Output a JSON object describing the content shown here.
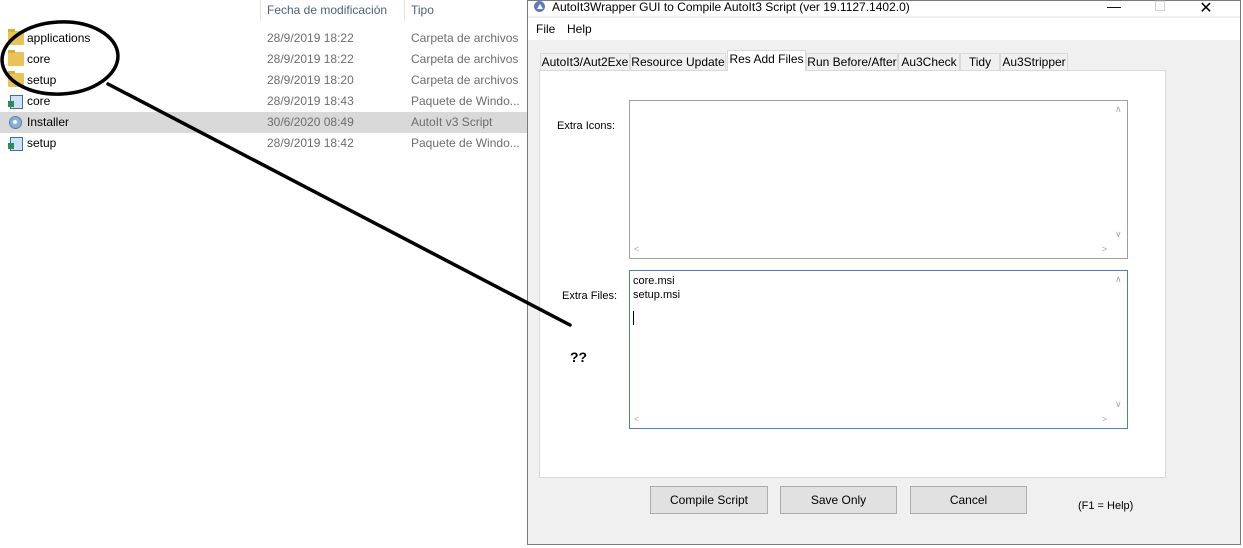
{
  "explorer": {
    "columns": {
      "date": "Fecha de modificación",
      "type": "Tipo"
    },
    "rows": [
      {
        "name": "applications",
        "date": "28/9/2019 18:22",
        "type": "Carpeta de archivos",
        "icon": "folder-icon"
      },
      {
        "name": "core",
        "date": "28/9/2019 18:22",
        "type": "Carpeta de archivos",
        "icon": "folder-icon"
      },
      {
        "name": "setup",
        "date": "28/9/2019 18:20",
        "type": "Carpeta de archivos",
        "icon": "folder-icon"
      },
      {
        "name": "core",
        "date": "28/9/2019 18:43",
        "type": "Paquete de Windo...",
        "icon": "msi-package-icon"
      },
      {
        "name": "Installer",
        "date": "30/6/2020 08:49",
        "type": "AutoIt v3 Script",
        "icon": "autoit-script-icon"
      },
      {
        "name": "setup",
        "date": "28/9/2019 18:42",
        "type": "Paquete de Windo...",
        "icon": "msi-package-icon"
      }
    ]
  },
  "dialog": {
    "title": "AutoIt3Wrapper GUI to Compile AutoIt3 Script (ver 19.1127.1402.0)",
    "window_controls": {
      "minimize": "—",
      "maximize": "☐",
      "close": "✕"
    },
    "menu": {
      "file": "File",
      "help": "Help"
    },
    "tabs": [
      {
        "label": "AutoIt3/Aut2Exe"
      },
      {
        "label": "Resource Update"
      },
      {
        "label": "Res Add Files"
      },
      {
        "label": "Run Before/After"
      },
      {
        "label": "Au3Check"
      },
      {
        "label": "Tidy"
      },
      {
        "label": "Au3Stripper"
      }
    ],
    "active_tab": "Res Add Files",
    "extra_icons": {
      "label": "Extra Icons:",
      "value": ""
    },
    "extra_files": {
      "label": "Extra Files:",
      "value": "core.msi\nsetup.msi\n"
    },
    "buttons": {
      "compile": "Compile Script",
      "save": "Save Only",
      "cancel": "Cancel"
    },
    "f1_help": "(F1 = Help)"
  },
  "annotation": {
    "text": "??"
  }
}
